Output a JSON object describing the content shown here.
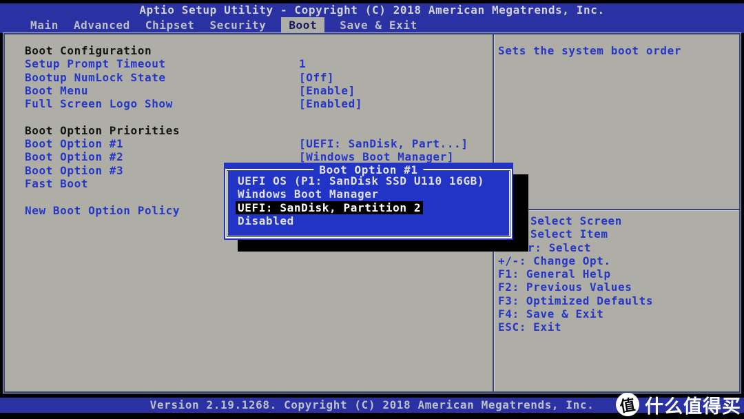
{
  "header": {
    "title": "Aptio Setup Utility - Copyright (C) 2018 American Megatrends, Inc.",
    "tabs": [
      {
        "label": "Main",
        "selected": false
      },
      {
        "label": "Advanced",
        "selected": false
      },
      {
        "label": "Chipset",
        "selected": false
      },
      {
        "label": "Security",
        "selected": false
      },
      {
        "label": "Boot",
        "selected": true
      },
      {
        "label": "Save & Exit",
        "selected": false
      }
    ]
  },
  "main_panel": {
    "rows": [
      {
        "type": "section",
        "label": "Boot Configuration"
      },
      {
        "type": "option",
        "label": "Setup Prompt Timeout",
        "value": "1"
      },
      {
        "type": "option",
        "label": "Bootup NumLock State",
        "value": "[Off]"
      },
      {
        "type": "option",
        "label": "Boot Menu",
        "value": "[Enable]"
      },
      {
        "type": "option",
        "label": "Full Screen Logo Show",
        "value": "[Enabled]"
      },
      {
        "type": "blank"
      },
      {
        "type": "section",
        "label": "Boot Option Priorities"
      },
      {
        "type": "option",
        "label": "Boot Option #1",
        "value": "[UEFI: SanDisk, Part...]"
      },
      {
        "type": "option",
        "label": "Boot Option #2",
        "value": "[Windows Boot Manager]"
      },
      {
        "type": "option",
        "label": "Boot Option #3",
        "value": ""
      },
      {
        "type": "option",
        "label": "Fast Boot",
        "value": ""
      },
      {
        "type": "blank"
      },
      {
        "type": "option",
        "label": "New Boot Option Policy",
        "value": ""
      }
    ]
  },
  "help_panel": {
    "description": "Sets the system boot order",
    "keys": [
      "Select Screen",
      "Select Item",
      "r: Select",
      "+/-: Change Opt.",
      "F1: General Help",
      "F2: Previous Values",
      "F3: Optimized Defaults",
      "F4: Save & Exit",
      "ESC: Exit"
    ]
  },
  "popup": {
    "title": "Boot Option #1",
    "options": [
      {
        "label": "UEFI OS (P1: SanDisk SSD U110 16GB)",
        "selected": false
      },
      {
        "label": "Windows Boot Manager",
        "selected": false
      },
      {
        "label": "UEFI: SanDisk, Partition 2",
        "selected": true
      },
      {
        "label": "Disabled",
        "selected": false
      }
    ]
  },
  "footer": {
    "text": "Version 2.19.1268. Copyright (C) 2018 American Megatrends, Inc."
  },
  "watermark": {
    "badge": "值",
    "text": "什么值得买"
  },
  "colors": {
    "header_blue": "#2a31a2",
    "popup_blue": "#2134c6",
    "body_gray": "#aeaea6",
    "item_blue": "#2636c9",
    "section_text": "#141414",
    "selected_tab_text": "#16165e",
    "highlight_bg": "#000000",
    "highlight_text": "#ffffff"
  }
}
